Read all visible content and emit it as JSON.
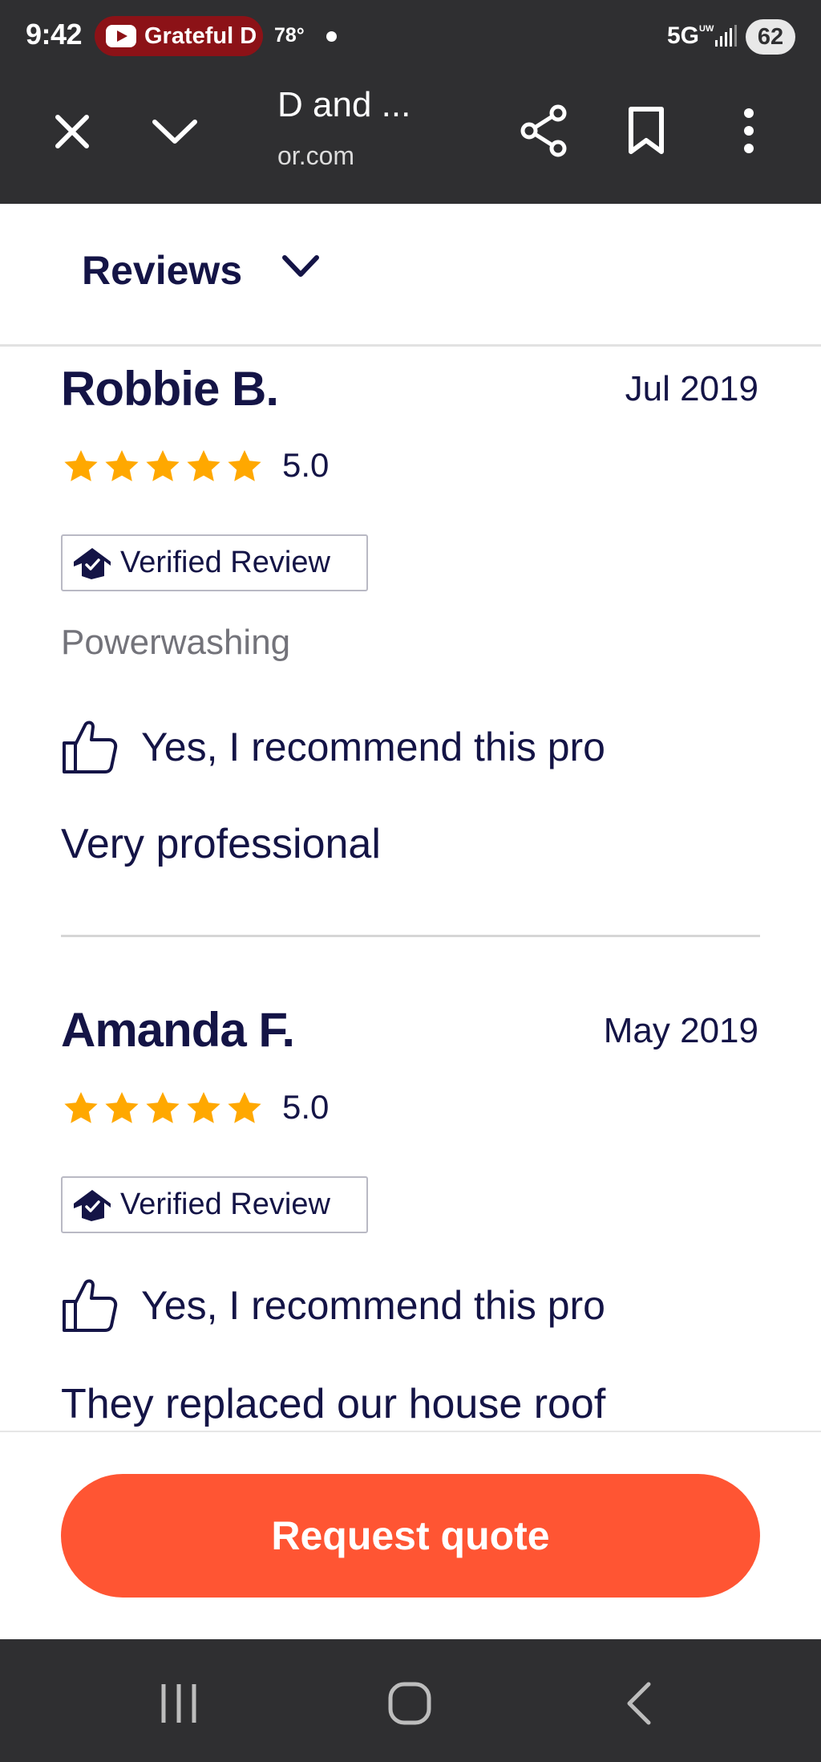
{
  "status_bar": {
    "time": "9:42",
    "media_pill": "Grateful D",
    "temperature": "78°",
    "network": "5G",
    "network_sub": "UW",
    "battery": "62"
  },
  "browser": {
    "title": "D and ...",
    "url": "or.com"
  },
  "section_header": {
    "label": "Reviews"
  },
  "reviews": [
    {
      "name": "Robbie B.",
      "date": "Jul 2019",
      "rating": "5.0",
      "stars": 5,
      "verified_label": "Verified Review",
      "category": "Powerwashing",
      "recommend_text": "Yes, I recommend this pro",
      "body": "Very professional"
    },
    {
      "name": "Amanda F.",
      "date": "May 2019",
      "rating": "5.0",
      "stars": 5,
      "verified_label": "Verified Review",
      "recommend_text": "Yes, I recommend this pro",
      "body": "They replaced our house roof"
    }
  ],
  "cta": {
    "label": "Request quote"
  },
  "colors": {
    "star": "#ffa800",
    "cta": "#ff5533",
    "text": "#141446",
    "chrome": "#2f2f31"
  }
}
